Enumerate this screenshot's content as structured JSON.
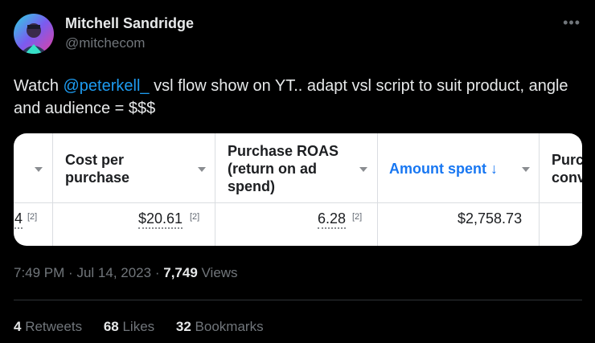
{
  "author": {
    "name": "Mitchell Sandridge",
    "handle": "@mitchecom"
  },
  "more_icon": "more-dots-icon",
  "tweet": {
    "text_before": "Watch ",
    "mention": "@peterkell_",
    "text_after": " vsl flow show on YT.. adapt vsl script to suit product, angle and audience = $$$"
  },
  "media_table": {
    "headers": {
      "cost_line1": "Cost per",
      "cost_line2": "purchase",
      "roas_line1": "Purchase ROAS",
      "roas_line2": "(return on ad",
      "roas_line3": "spend)",
      "amount": "Amount spent ↓",
      "conv_line1": "Purc",
      "conv_line2": "conv"
    },
    "row": {
      "partial_first": "4",
      "partial_first_fn": "[2]",
      "cost": "$20.61",
      "cost_fn": "[2]",
      "roas": "6.28",
      "roas_fn": "[2]",
      "amount": "$2,758.73"
    },
    "accent_color": "#1877f2"
  },
  "meta": {
    "time": "7:49 PM",
    "date": "Jul 14, 2023",
    "views_count": "7,749",
    "views_label": "Views"
  },
  "stats": {
    "retweets_count": "4",
    "retweets_label": "Retweets",
    "likes_count": "68",
    "likes_label": "Likes",
    "bookmarks_count": "32",
    "bookmarks_label": "Bookmarks"
  },
  "colors": {
    "background": "#000000",
    "text": "#e7e9ea",
    "muted": "#71767b",
    "link": "#1d9bf0"
  }
}
